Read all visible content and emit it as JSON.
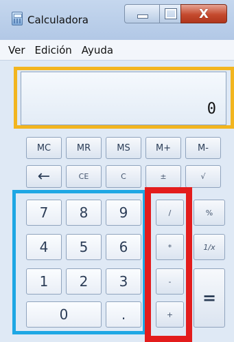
{
  "window": {
    "title": "Calculadora",
    "close_label": "X"
  },
  "menu": {
    "items": [
      "Ver",
      "Edición",
      "Ayuda"
    ]
  },
  "display": {
    "value": "0"
  },
  "keys": {
    "memory": [
      "MC",
      "MR",
      "MS",
      "M+",
      "M-"
    ],
    "row2": [
      "←",
      "CE",
      "C",
      "±",
      "√"
    ],
    "digits": {
      "d7": "7",
      "d8": "8",
      "d9": "9",
      "d4": "4",
      "d5": "5",
      "d6": "6",
      "d1": "1",
      "d2": "2",
      "d3": "3",
      "d0": "0"
    },
    "decimal": ".",
    "divide": "/",
    "multiply": "*",
    "subtract": "-",
    "add": "+",
    "percent": "%",
    "reciprocal": "1/x",
    "equals": "="
  },
  "highlight_colors": {
    "display": "#f2b51f",
    "digits": "#1ea7e4",
    "operators": "#e31c1c"
  }
}
